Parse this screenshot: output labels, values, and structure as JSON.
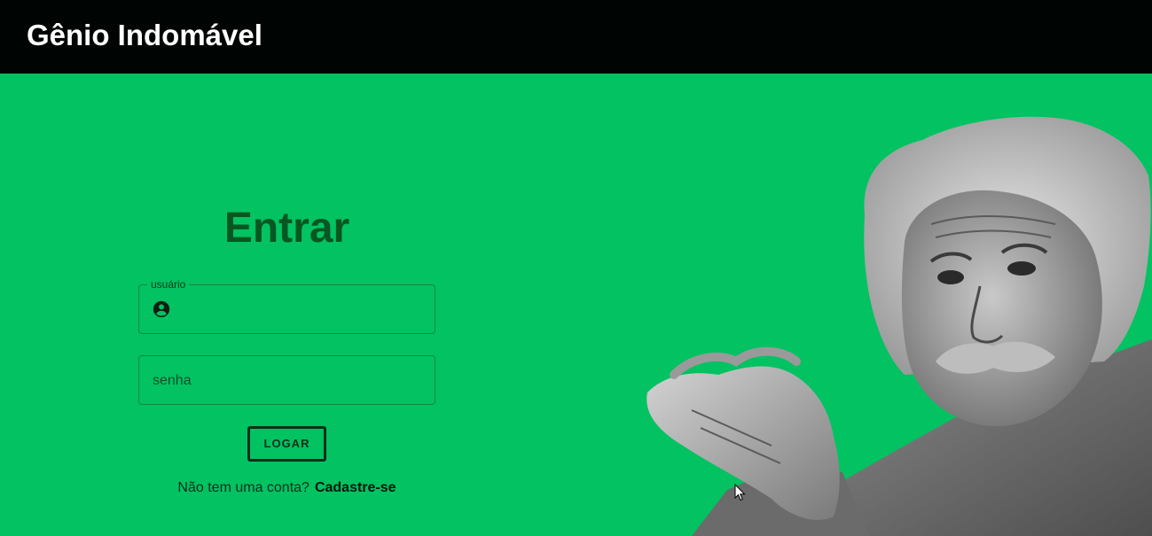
{
  "header": {
    "brand": "Gênio Indomável"
  },
  "login": {
    "title": "Entrar",
    "username_legend": "usuário",
    "username_value": "",
    "password_placeholder": "senha",
    "password_value": "",
    "login_button": "LOGAR",
    "no_account_text": "Não tem uma conta?",
    "signup_link": "Cadastre-se"
  },
  "icons": {
    "user": "account-circle-icon",
    "cursor": "mouse-pointer-icon"
  },
  "colors": {
    "header_bg": "#000403",
    "page_bg": "#02c262",
    "title": "#085622",
    "text_dark": "#0c2e18"
  }
}
